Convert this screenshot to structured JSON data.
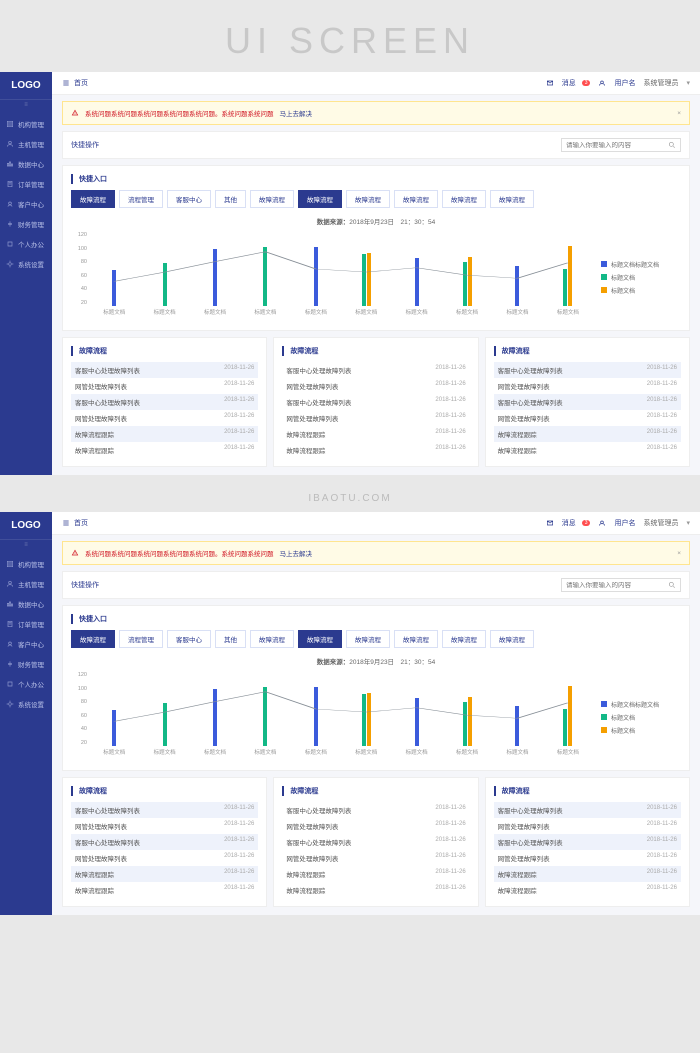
{
  "hero": "UI SCREEN",
  "watermark": "IBAOTU.COM",
  "sidebar": {
    "logo": "LOGO",
    "items": [
      {
        "icon": "building-icon",
        "label": "机构管理"
      },
      {
        "icon": "user-icon",
        "label": "主机管理"
      },
      {
        "icon": "data-icon",
        "label": "数据中心"
      },
      {
        "icon": "order-icon",
        "label": "订单管理"
      },
      {
        "icon": "customer-icon",
        "label": "客户中心"
      },
      {
        "icon": "finance-icon",
        "label": "财务管理"
      },
      {
        "icon": "personal-icon",
        "label": "个人办公"
      },
      {
        "icon": "settings-icon",
        "label": "系统设置"
      }
    ]
  },
  "topbar": {
    "home": "首页",
    "message": "消息",
    "message_count": "3",
    "user_center": "用户名",
    "admin": "系统管理员"
  },
  "alert": {
    "text": "系统问题系统问题系统问题系统问题系统问题。系统问题系统问题",
    "link": "马上去解决"
  },
  "toolbar": {
    "title": "快捷操作",
    "search_placeholder": "请输入你要输入的内容"
  },
  "quick": {
    "title": "快捷入口",
    "tabs": [
      "故障流程",
      "流程管理",
      "客服中心",
      "其他",
      "故障流程",
      "故障流程",
      "故障流程",
      "故障流程",
      "故障流程",
      "故障流程"
    ],
    "active": [
      0,
      5
    ]
  },
  "chart_data": {
    "type": "bar",
    "title_prefix": "数据来源：",
    "title_date": "2018年9月23日",
    "title_time": "21：30：54",
    "categories": [
      "标题文档",
      "标题文档",
      "标题文档",
      "标题文档",
      "标题文档",
      "标题文档",
      "标题文档",
      "标题文档",
      "标题文档",
      "标题文档"
    ],
    "ylim": [
      0,
      120
    ],
    "yticks": [
      120,
      100,
      80,
      60,
      40,
      20
    ],
    "series": [
      {
        "name": "标题文档标题文档",
        "color": "#3b5bdb",
        "values": [
          58,
          0,
          92,
          0,
          95,
          0,
          78,
          0,
          65,
          0
        ]
      },
      {
        "name": "标题文档",
        "color": "#12b886",
        "values": [
          0,
          70,
          0,
          95,
          0,
          85,
          0,
          72,
          0,
          60
        ]
      },
      {
        "name": "标题文档",
        "color": "#f59f00",
        "values": [
          0,
          0,
          0,
          0,
          0,
          86,
          0,
          80,
          0,
          98
        ]
      }
    ],
    "line": {
      "color": "#868e96",
      "values": [
        40,
        55,
        72,
        88,
        60,
        55,
        62,
        50,
        45,
        70
      ]
    }
  },
  "panels": [
    {
      "title": "故障流程",
      "rows": [
        {
          "label": "客服中心处理故障列表",
          "date": "2018-11-26",
          "hl": true
        },
        {
          "label": "网管处理故障列表",
          "date": "2018-11-26"
        },
        {
          "label": "客服中心处理故障列表",
          "date": "2018-11-26",
          "hl": true
        },
        {
          "label": "网管处理故障列表",
          "date": "2018-11-26"
        },
        {
          "label": "故障流程跟踪",
          "date": "2018-11-26",
          "hl": true
        },
        {
          "label": "故障流程跟踪",
          "date": "2018-11-26"
        }
      ]
    },
    {
      "title": "故障流程",
      "rows": [
        {
          "label": "客服中心处理故障列表",
          "date": "2018-11-26"
        },
        {
          "label": "网管处理故障列表",
          "date": "2018-11-26"
        },
        {
          "label": "客服中心处理故障列表",
          "date": "2018-11-26"
        },
        {
          "label": "网管处理故障列表",
          "date": "2018-11-26"
        },
        {
          "label": "故障流程跟踪",
          "date": "2018-11-26"
        },
        {
          "label": "故障流程跟踪",
          "date": "2018-11-26"
        }
      ]
    },
    {
      "title": "故障流程",
      "rows": [
        {
          "label": "客服中心处理故障列表",
          "date": "2018-11-26",
          "hl": true
        },
        {
          "label": "网管处理故障列表",
          "date": "2018-11-26"
        },
        {
          "label": "客服中心处理故障列表",
          "date": "2018-11-26",
          "hl": true
        },
        {
          "label": "网管处理故障列表",
          "date": "2018-11-26"
        },
        {
          "label": "故障流程跟踪",
          "date": "2018-11-26",
          "hl": true
        },
        {
          "label": "故障流程跟踪",
          "date": "2018-11-26"
        }
      ]
    }
  ]
}
